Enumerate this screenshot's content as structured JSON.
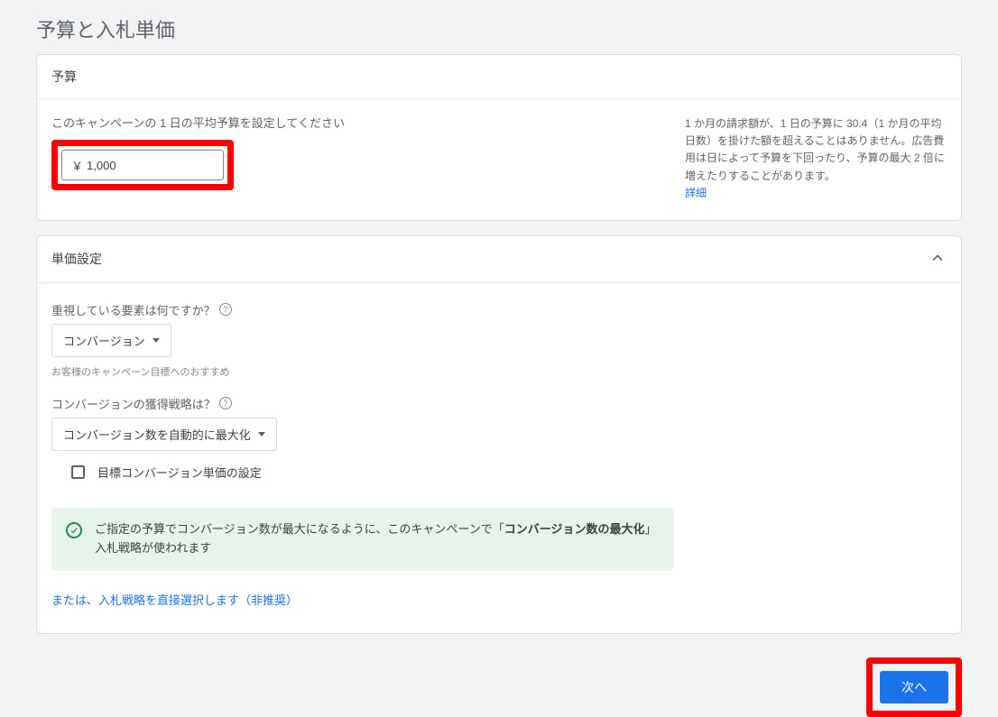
{
  "page_title": "予算と入札単価",
  "budget": {
    "header": "予算",
    "label": "このキャンペーンの 1 日の平均予算を設定してください",
    "currency_symbol": "￥",
    "value": "1,000",
    "side_note": "1 か月の請求額が、1 日の予算に 30.4（1 か月の平均日数）を掛けた額を超えることはありません。広告費用は日によって予算を下回ったり、予算の最大 2 倍に増えたりすることがあります。",
    "side_note_link": "詳細"
  },
  "bidding": {
    "header": "単価設定",
    "focus_question": "重視している要素は何ですか？",
    "focus_value": "コンバージョン",
    "focus_hint": "お客様のキャンペーン目標へのおすすめ",
    "strategy_question": "コンバージョンの獲得戦略は？",
    "strategy_value": "コンバージョン数を自動的に最大化",
    "checkbox_label": "目標コンバージョン単価の設定",
    "info_banner_pre": "ご指定の予算でコンバージョン数が最大になるように、このキャンペーンで「",
    "info_banner_bold": "コンバージョン数の最大化",
    "info_banner_post": "」入札戦略が使われます",
    "alt_link": "または、入札戦略を直接選択します（非推奨）"
  },
  "footer": {
    "next_label": "次へ"
  }
}
